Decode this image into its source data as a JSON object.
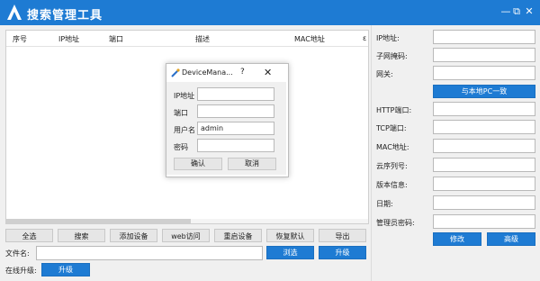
{
  "app": {
    "title": "搜索管理工具"
  },
  "window": {
    "min": "—",
    "restore": "⧉",
    "close": "✕"
  },
  "table": {
    "columns": [
      "序号",
      "IP地址",
      "端口",
      "描述",
      "MAC地址",
      "ɛ"
    ]
  },
  "toolbar": {
    "buttons": [
      "全选",
      "搜索",
      "添加设备",
      "web访问",
      "重启设备",
      "恢复默认",
      "导出"
    ]
  },
  "file": {
    "label": "文件名:",
    "value": "",
    "browse": "浏选",
    "upgrade": "升级"
  },
  "online": {
    "label": "在线升级:",
    "upgrade": "升级"
  },
  "dialog": {
    "title": "DeviceMana...",
    "help": "?",
    "close": "✕",
    "fields": [
      {
        "label": "IP地址",
        "value": ""
      },
      {
        "label": "端口",
        "value": ""
      },
      {
        "label": "用户名",
        "value": "admin"
      },
      {
        "label": "密码",
        "value": ""
      }
    ],
    "ok": "确认",
    "cancel": "取消"
  },
  "side": {
    "fields": [
      {
        "label": "IP地址:",
        "value": ""
      },
      {
        "label": "子网掩码:",
        "value": ""
      },
      {
        "label": "网关:",
        "value": ""
      },
      {
        "label": "HTTP端口:",
        "value": ""
      },
      {
        "label": "TCP端口:",
        "value": ""
      },
      {
        "label": "MAC地址:",
        "value": ""
      },
      {
        "label": "云序列号:",
        "value": ""
      },
      {
        "label": "版本信息:",
        "value": ""
      },
      {
        "label": "日期:",
        "value": ""
      },
      {
        "label": "管理员密码:",
        "value": ""
      }
    ],
    "same_as_pc": "与本地PC一致",
    "modify": "修改",
    "advanced": "高级"
  },
  "colors": {
    "accent": "#1e7bd3",
    "panel": "#f0f0f0"
  }
}
